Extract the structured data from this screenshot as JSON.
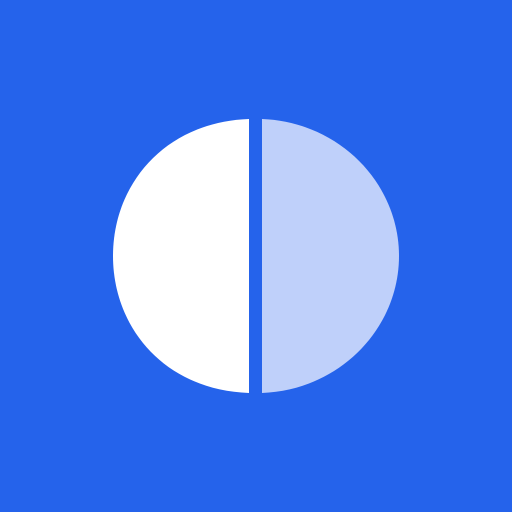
{
  "icon": {
    "name": "split-circle-icon",
    "colors": {
      "background": "#2563EB",
      "left_half": "#FFFFFF",
      "right_half": "#BFD0FA"
    }
  }
}
